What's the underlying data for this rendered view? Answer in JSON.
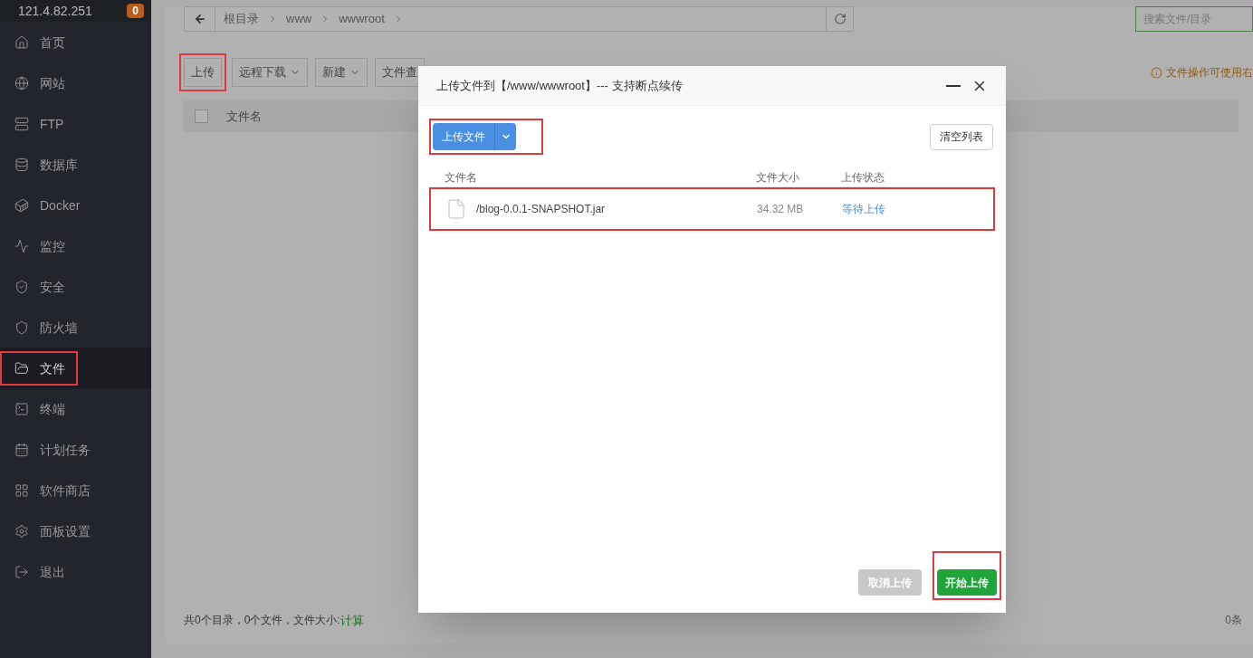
{
  "server": {
    "ip": "121.4.82.251",
    "badge": "0"
  },
  "sidebar": {
    "items": [
      {
        "label": "首页",
        "selected": false,
        "annotated": false
      },
      {
        "label": "网站",
        "selected": false,
        "annotated": false
      },
      {
        "label": "FTP",
        "selected": false,
        "annotated": false
      },
      {
        "label": "数据库",
        "selected": false,
        "annotated": false
      },
      {
        "label": "Docker",
        "selected": false,
        "annotated": false
      },
      {
        "label": "监控",
        "selected": false,
        "annotated": false
      },
      {
        "label": "安全",
        "selected": false,
        "annotated": false
      },
      {
        "label": "防火墙",
        "selected": false,
        "annotated": false
      },
      {
        "label": "文件",
        "selected": true,
        "annotated": true
      },
      {
        "label": "终端",
        "selected": false,
        "annotated": false
      },
      {
        "label": "计划任务",
        "selected": false,
        "annotated": false
      },
      {
        "label": "软件商店",
        "selected": false,
        "annotated": false
      },
      {
        "label": "面板设置",
        "selected": false,
        "annotated": false
      },
      {
        "label": "退出",
        "selected": false,
        "annotated": false
      }
    ]
  },
  "breadcrumb": [
    "根目录",
    "www",
    "wwwroot"
  ],
  "search": {
    "placeholder": "搜索文件/目录"
  },
  "toolbar": [
    {
      "label": "上传",
      "dropdown": false,
      "annotated": true
    },
    {
      "label": "远程下载",
      "dropdown": true,
      "annotated": false
    },
    {
      "label": "新建",
      "dropdown": true,
      "annotated": false
    },
    {
      "label": "文件查",
      "dropdown": false,
      "annotated": false
    }
  ],
  "hint": "文件操作可使用右",
  "table": {
    "checked": false,
    "columns": [
      "文件名"
    ]
  },
  "footer": {
    "summary": "共0个目录，0个文件，文件大小: ",
    "link": "计算",
    "pagination": "0条"
  },
  "dialog": {
    "title": "上传文件到【/www/wwwroot】--- 支持断点续传",
    "upload_button": {
      "label": "上传文件",
      "annotated": true
    },
    "clear_button": "清空列表",
    "columns": [
      "文件名",
      "文件大小",
      "上传状态"
    ],
    "rows": [
      {
        "name": "/blog-0.0.1-SNAPSHOT.jar",
        "size": "34.32 MB",
        "status": "等待上传"
      }
    ],
    "rows_annotated": true,
    "cancel": {
      "label": "取消上传",
      "disabled": true
    },
    "start": {
      "label": "开始上传",
      "annotated": true
    }
  }
}
